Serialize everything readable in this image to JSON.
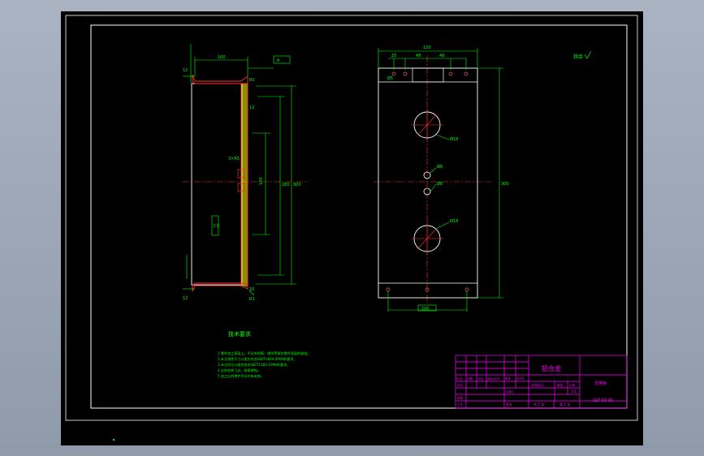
{
  "colors": {
    "background": "#000000",
    "frame": "#ffffff",
    "part_outline": "#ffffff",
    "dimension": "#00ff00",
    "centerline": "#ff3030",
    "hatch": "#ffff00",
    "title_block": "#ff00ff",
    "outer_bg": "#9aa3b2"
  },
  "title_block": {
    "material": "铝合金",
    "drawing_number": "QLT-03-05",
    "part_name": "支撑板",
    "scale": "1:5",
    "sheet_total": "共 1 张",
    "sheet_index": "第 1 张",
    "headers": [
      "标记",
      "处数",
      "分区",
      "更改文件号",
      "签名",
      "年月日"
    ],
    "stage_headers": [
      "阶段标记",
      "重量",
      "比例"
    ],
    "roles": [
      "设计",
      "审核",
      "工艺",
      "批准",
      "标准化"
    ]
  },
  "technical_requirements": {
    "heading": "技术要求",
    "items": [
      "1.零件加工表面上，不应有划痕、擦伤等损伤零件表面的缺陷。",
      "2.未注线性尺寸公差应符合GB/T1804-2000的要求。",
      "3.未注形位公差应符合GB/T1184-1996的要求。",
      "4.去除毛刺飞边，锐角倒钝。",
      "5.加工后的零件不允许有毛刺。"
    ]
  },
  "roughness_note": "其余",
  "side_view": {
    "dims": {
      "top_width": "100",
      "flange_left": "12",
      "flange_bottom": "12",
      "overall_height": "300",
      "inner_height": "280",
      "span": "100",
      "slot": "3×R5",
      "depth": "12",
      "thickness": "10",
      "radius_top": "R1",
      "radius_bottom": "R1",
      "chamfer": "C1"
    },
    "datum_label": "A"
  },
  "front_view": {
    "dims": {
      "overall_width": "120",
      "hole_spacing_a": "25",
      "hole_spacing_b": "48",
      "hole_spacing_c": "48",
      "overall_height": "300",
      "large_hole": "Ø18",
      "small_hole_top": "Ø8",
      "small_hole_bottom": "Ø8",
      "large_hole_2": "Ø18",
      "bottom_spacing": "100",
      "corner_hole": "Ø5"
    }
  }
}
